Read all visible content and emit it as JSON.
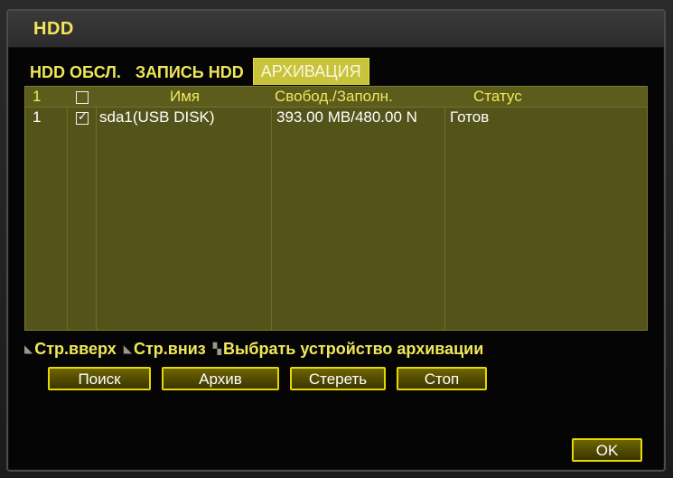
{
  "window": {
    "title": "HDD"
  },
  "tabs": [
    {
      "label": "HDD ОБСЛ.",
      "active": false
    },
    {
      "label": "ЗАПИСЬ HDD",
      "active": false
    },
    {
      "label": "АРХИВАЦИЯ",
      "active": true
    }
  ],
  "table": {
    "headers": {
      "num": "1",
      "name": "Имя",
      "free": "Свобод./Заполн.",
      "status": "Статус"
    },
    "rows": [
      {
        "num": "1",
        "checked": true,
        "name": "sda1(USB DISK)",
        "free": "393.00 MB/480.00 N",
        "status": "Готов"
      }
    ]
  },
  "hints": {
    "page_up": "Стр.вверх",
    "page_down": "Стр.вниз",
    "select_device": "Выбрать устройство архивации"
  },
  "buttons": {
    "search": "Поиск",
    "archive": "Архив",
    "erase": "Стереть",
    "stop": "Стоп",
    "ok": "OK"
  },
  "colors": {
    "accent_yellow": "#f0e85a",
    "table_bg": "#54541a",
    "active_tab_bg": "#c9c33b",
    "button_border": "#e6d800"
  }
}
